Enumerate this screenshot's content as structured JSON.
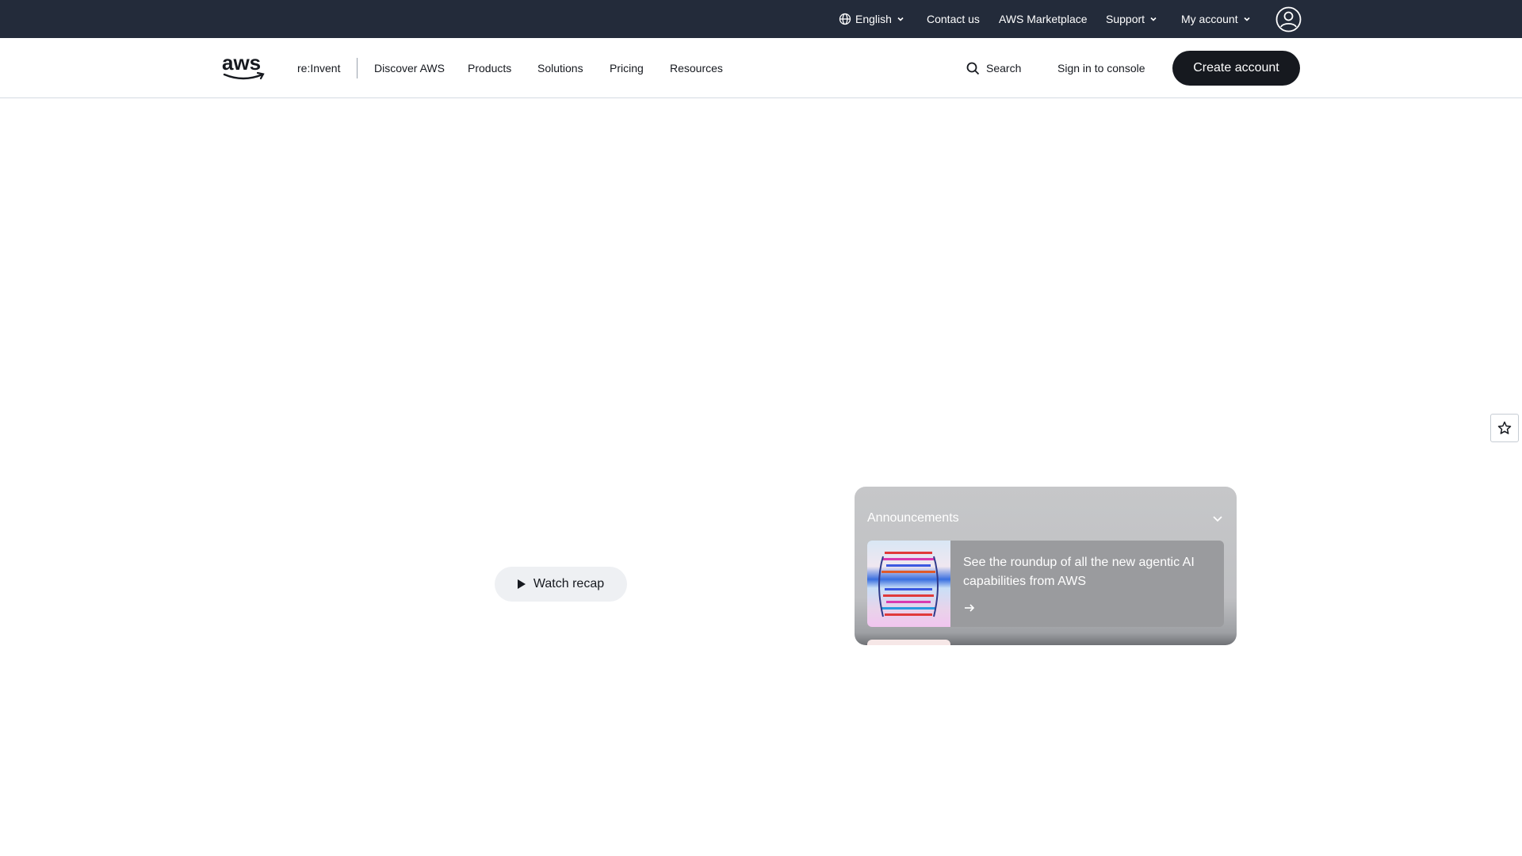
{
  "utility_bar": {
    "language": "English",
    "contact": "Contact us",
    "marketplace": "AWS Marketplace",
    "support": "Support",
    "my_account": "My account"
  },
  "nav": {
    "logo_text": "aws",
    "reinvent": "re:Invent",
    "discover": "Discover AWS",
    "products": "Products",
    "solutions": "Solutions",
    "pricing": "Pricing",
    "resources": "Resources",
    "search": "Search",
    "sign_in": "Sign in to console",
    "create_account": "Create account"
  },
  "hero": {
    "watch_recap": "Watch recap"
  },
  "announcements": {
    "heading": "Announcements",
    "items": [
      {
        "title": "See the roundup of all the new agentic AI capabilities from AWS"
      }
    ]
  },
  "icons": {
    "globe": "globe-icon",
    "chevron": "chevron-down-icon",
    "account": "user-circle-icon",
    "search": "search-icon",
    "play": "play-icon",
    "arrow": "arrow-right-icon",
    "star": "star-icon"
  },
  "colors": {
    "utility_bar_bg": "#232b3a",
    "primary_button_bg": "#16191f",
    "announcement_panel": "#c6c7c9"
  }
}
